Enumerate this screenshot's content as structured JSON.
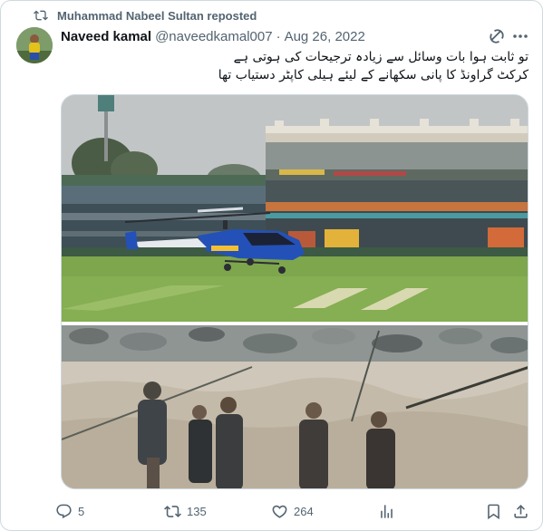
{
  "repost": {
    "label": "Muhammad Nabeel Sultan reposted"
  },
  "author": {
    "name": "Naveed kamal",
    "handle": "@naveedkamal007",
    "separator": "·",
    "date": "Aug 26, 2022"
  },
  "tweet": {
    "line1": "تو ثابت ہوا بات وسائل سے زیادہ ترجیحات کی ہوتی ہے",
    "line2": "کرکٹ گراونڈ کا پانی سکھانے کے لیئے ہیلی کاپٹر دستیاب تھا"
  },
  "media": {
    "top_image": "helicopter-drying-cricket-ground",
    "bottom_image": "men-crossing-flood-water-with-rope"
  },
  "actions": {
    "replies": "5",
    "reposts": "135",
    "likes": "264"
  },
  "colors": {
    "secondary_text": "#536471",
    "primary_text": "#0f1419",
    "border": "#cfd9de"
  },
  "icons": [
    "repost-icon",
    "grok-icon",
    "more-icon",
    "reply-icon",
    "like-icon",
    "views-icon",
    "bookmark-icon",
    "share-icon"
  ]
}
